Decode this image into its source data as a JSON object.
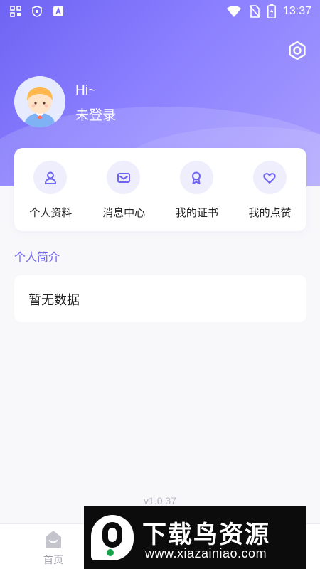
{
  "status_bar": {
    "time": "13:37",
    "left_icons": [
      "grid-icon",
      "shield-icon",
      "a-icon"
    ],
    "right_icons": [
      "wifi-icon",
      "no-sim-icon",
      "battery-icon"
    ]
  },
  "header": {
    "greeting": "Hi~",
    "login_status": "未登录",
    "settings_icon": "gear-icon"
  },
  "menu": [
    {
      "label": "个人资料",
      "icon": "user-icon"
    },
    {
      "label": "消息中心",
      "icon": "mail-icon"
    },
    {
      "label": "我的证书",
      "icon": "badge-icon"
    },
    {
      "label": "我的点赞",
      "icon": "heart-icon"
    }
  ],
  "intro": {
    "title": "个人简介",
    "content": "暂无数据"
  },
  "version": "v1.0.37",
  "tabs": [
    {
      "label": "首页",
      "icon": "home-icon",
      "active": false
    },
    {
      "label": "",
      "icon": "tab-icon",
      "active": false
    },
    {
      "label": "",
      "icon": "tab-icon",
      "active": true
    }
  ],
  "watermark": {
    "title": "下载鸟资源",
    "url": "www.xiazainiao.com"
  },
  "colors": {
    "accent": "#6e63f3",
    "header_gradient_start": "#6e63f3",
    "header_gradient_end": "#a99dfe",
    "icon_bg": "#efeefd",
    "page_bg": "#f8f8fb"
  }
}
